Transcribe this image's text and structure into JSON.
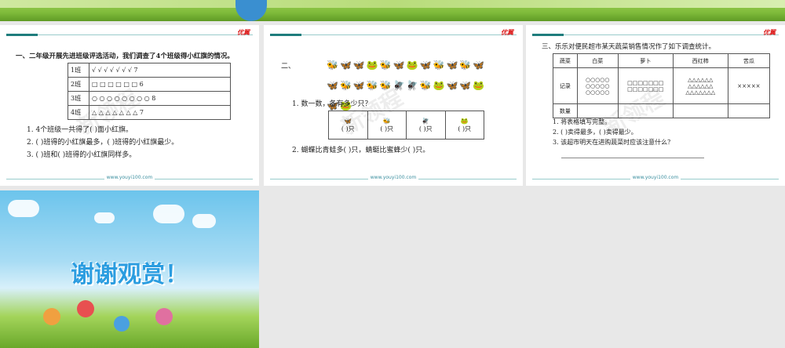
{
  "slide1": {
    "logo": "优翼",
    "title": "一、二年级开展先进班级评选活动，我们调查了4个班级得小红旗的情况。",
    "rows": [
      {
        "cls": "1班",
        "marks": "√ √ √ √ √ √ √ 7"
      },
      {
        "cls": "2班",
        "marks": "□ □ □ □ □ □ 6"
      },
      {
        "cls": "3班",
        "marks": "○ ○ ○ ○ ○ ○ ○ ○ 8"
      },
      {
        "cls": "4班",
        "marks": "△ △ △ △ △ △ △ 7"
      }
    ],
    "q1": "1. 4个班级一共得了(      )面小红旗。",
    "q2": "2. (      )班得的小红旗最多，(      )班得的小红旗最少。",
    "q3": "3. (      )班和(      )班得的小红旗同样多。",
    "url": "www.youyi100.com"
  },
  "slide2": {
    "logo": "优翼",
    "label": "二、",
    "animals": "🐝🦋🦋🐸🐝🦋🐸🦋🐝🦋🐝🦋🦋🐝🦋🐝🐝🪰🪰🐝🐸🦋🦋🐸🦋🐸",
    "q1": "1. 数一数，各有多少只？",
    "cells": [
      "(    )只",
      "(    )只",
      "(    )只",
      "(    )只"
    ],
    "cell_icons": [
      "🦋",
      "🐝",
      "🪰",
      "🐸"
    ],
    "q2": "2. 蝴蝶比青蛙多(        )只，蜻蜓比蜜蜂少(        )只。",
    "url": "www.youyi100.com"
  },
  "slide3": {
    "logo": "优翼",
    "title": "三、乐乐对便民超市某天蔬菜销售情况作了如下调查统计。",
    "headers": [
      "蔬菜",
      "白菜",
      "萝卜",
      "西红柿",
      "苦瓜"
    ],
    "record_label": "记录",
    "records": [
      "○○○○○ ○○○○○ ○○○○○",
      "□□□□□□□ □□□□□□□",
      "△△△△△△ △△△△△△ △△△△△△△",
      "×××××"
    ],
    "count_label": "数量",
    "q1": "1. 将表格填写完整。",
    "q2": "2. (          )卖得最多，(          )卖得最少。",
    "q3": "3. 该超市明天在进购蔬菜时应该注意什么？",
    "url": "www.youyi100.com"
  },
  "slide4": {
    "title": "谢谢观赏！"
  }
}
